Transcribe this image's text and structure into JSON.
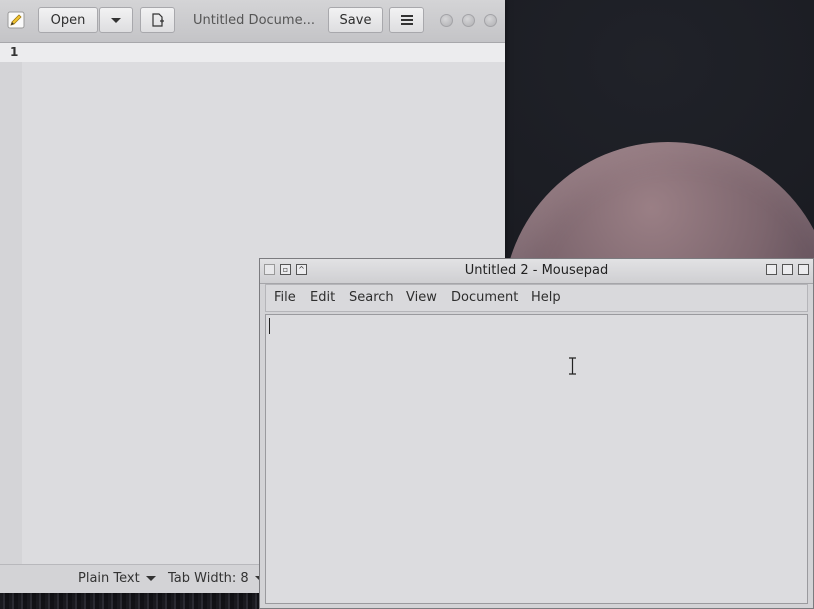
{
  "gedit": {
    "open_label": "Open",
    "save_label": "Save",
    "document_title": "Untitled Docume...",
    "line_number": "1",
    "status": {
      "language": "Plain Text",
      "tab_width": "Tab Width: 8"
    }
  },
  "mousepad": {
    "title": "Untitled 2 - Mousepad",
    "menu": [
      "File",
      "Edit",
      "Search",
      "View",
      "Document",
      "Help"
    ]
  },
  "icons": {
    "app": "pencil-icon",
    "open_dropdown": "chevron-down-icon",
    "new_document": "new-document-icon",
    "menu": "hamburger-menu-icon",
    "text_cursor": "i-beam-icon"
  }
}
